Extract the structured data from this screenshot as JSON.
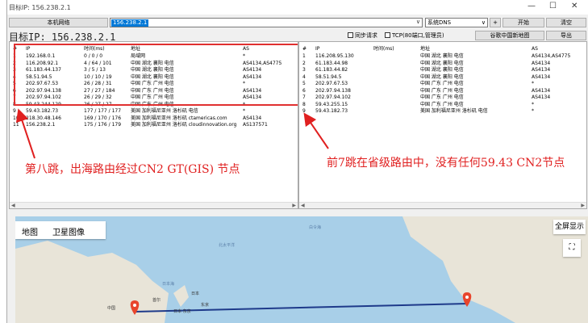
{
  "window": {
    "title": "目标IP: 156.238.2.1",
    "controls": [
      "—",
      "☐",
      "✕"
    ]
  },
  "toolbar": {
    "local_network_label": "本机网络",
    "ip_value": "156.238.2.1",
    "dns_select": "系统DNS",
    "down_arrow": "∨",
    "plus_label": "+",
    "start_label": "开始",
    "clear_label": "清空",
    "export_label": "导出",
    "map_label": "谷歌中国新地图"
  },
  "target_line": "目标IP: 156.238.2.1",
  "options": {
    "sync_request": "同步请求",
    "tcp_mode": "TCP(80端口,管理员)"
  },
  "left_table": {
    "headers": [
      "#",
      "IP",
      "时间(ms)",
      "地址",
      "AS"
    ],
    "rows": [
      [
        "1",
        "192.168.0.1",
        "0 / 0 / 0",
        "局域网",
        "*"
      ],
      [
        "2",
        "116.208.92.1",
        "4 / 64 / 101",
        "中国 湖北 襄阳 电信",
        "AS4134,AS4775"
      ],
      [
        "3",
        "61.183.44.137",
        "3 / 5 / 13",
        "中国 湖北 襄阳 电信",
        "AS4134"
      ],
      [
        "4",
        "58.51.94.5",
        "10 / 10 / 19",
        "中国 湖北 襄阳 电信",
        "AS4134"
      ],
      [
        "5",
        "202.97.67.53",
        "26 / 28 / 31",
        "中国 广东 广州 电信",
        "*"
      ],
      [
        "6",
        "202.97.94.138",
        "27 / 27 / 184",
        "中国 广东 广州 电信",
        "AS4134"
      ],
      [
        "7",
        "202.97.94.102",
        "26 / 29 / 32",
        "中国 广东 广州 电信",
        "AS4134"
      ],
      [
        "8",
        "59.43.244.129",
        "26 / 27 / 27",
        "中国 广东 广州 电信",
        "*"
      ],
      [
        "9",
        "59.43.182.73",
        "177 / 177 / 177",
        "美国 加利福尼亚州 洛杉矶 电信",
        "*"
      ],
      [
        "10",
        "218.30.48.146",
        "169 / 170 / 176",
        "美国 加利福尼亚州 洛杉矶 ctamericas.com",
        "AS4134"
      ],
      [
        "11",
        "156.238.2.1",
        "175 / 176 / 179",
        "美国 加利福尼亚州 洛杉矶 cloudinnovation.org",
        "AS137571"
      ]
    ]
  },
  "right_table": {
    "headers": [
      "#",
      "IP",
      "时间(ms)",
      "地址",
      "AS"
    ],
    "rows": [
      [
        "1",
        "116.208.95.130",
        "",
        "中国 湖北 襄阳 电信",
        "AS4134,AS4775"
      ],
      [
        "2",
        "61.183.44.98",
        "",
        "中国 湖北 襄阳 电信",
        "AS4134"
      ],
      [
        "3",
        "61.183.44.82",
        "",
        "中国 湖北 襄阳 电信",
        "AS4134"
      ],
      [
        "4",
        "58.51.94.5",
        "",
        "中国 湖北 襄阳 电信",
        "AS4134"
      ],
      [
        "5",
        "202.97.67.53",
        "",
        "中国 广东 广州 电信",
        "*"
      ],
      [
        "6",
        "202.97.94.138",
        "",
        "中国 广东 广州 电信",
        "AS4134"
      ],
      [
        "7",
        "202.97.94.102",
        "",
        "中国 广东 广州 电信",
        "AS4134"
      ],
      [
        "8",
        "59.43.255.15",
        "",
        "中国 广东 广州 电信",
        "*"
      ],
      [
        "9",
        "59.43.182.73",
        "",
        "美国 加利福尼亚州 洛杉矶 电信",
        "*"
      ]
    ]
  },
  "annotations": {
    "left": "第八跳，出海路由经过CN2 GT(GIS) 节点",
    "right": "前7跳在省级路由中，没有任何59.43 CN2节点"
  },
  "map": {
    "tab_map": "地图",
    "tab_satellite": "卫星图像",
    "fullscreen": "全屏显示",
    "expand_icon": "⛶",
    "labels": {
      "china": "中国",
      "japan": "日本",
      "tokyo": "东京",
      "sea_of_japan": "日本海",
      "seoul": "首尔",
      "bering": "白令海",
      "north_pacific": "北太平洋",
      "japan_sea_b": "日本 东京"
    }
  },
  "colors": {
    "accent": "#0078d7",
    "annotation_red": "#e02020",
    "water": "#a8cfe8",
    "land": "#e8e4d8",
    "route_line": "#1e3a8a",
    "marker": "#e8452c"
  }
}
